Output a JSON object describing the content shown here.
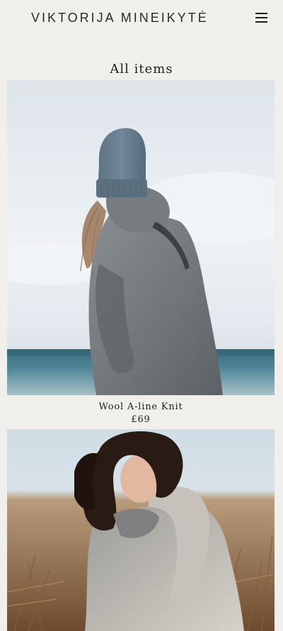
{
  "header": {
    "brand": "VIKTORIJA MINEIKYTĖ",
    "menu_icon": "hamburger-menu-icon"
  },
  "page": {
    "title": "All items"
  },
  "products": [
    {
      "name": "Wool A-line Knit",
      "price": "£69",
      "image_icon": "product-photo-grey-knit-sea"
    },
    {
      "name": "",
      "price": "",
      "image_icon": "product-photo-curly-hair-knit"
    }
  ],
  "colors": {
    "background": "#f1efeb",
    "text": "#1f1f1f"
  }
}
